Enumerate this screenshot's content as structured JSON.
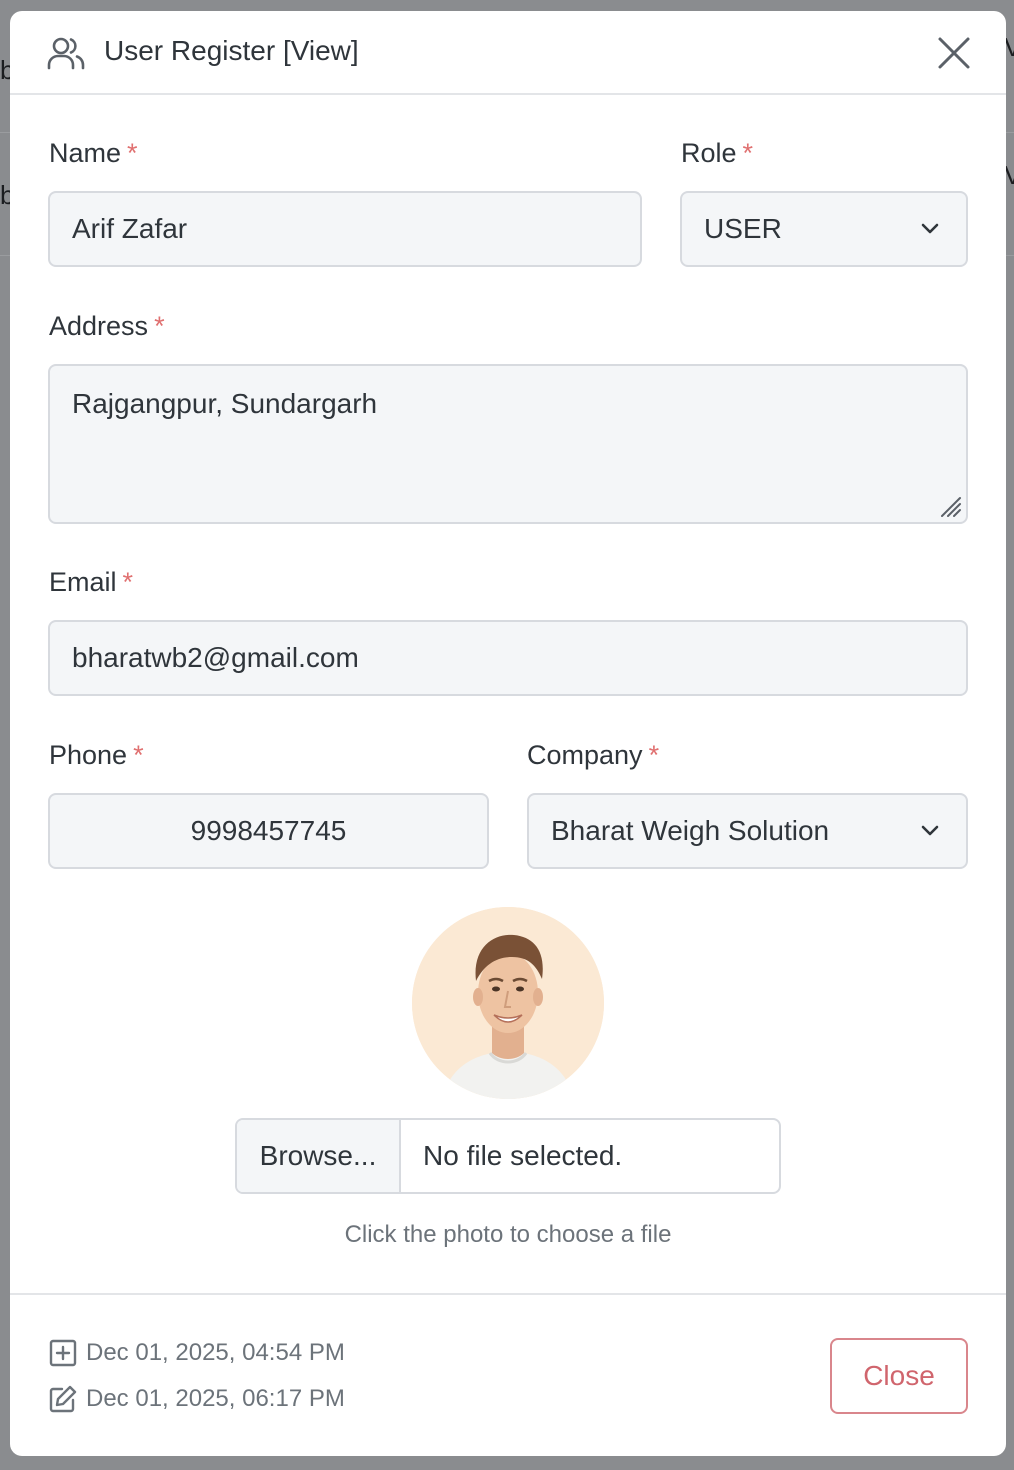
{
  "background": {
    "fragments": [
      "b",
      "b",
      "V",
      "V"
    ]
  },
  "modal": {
    "title": "User Register [View]",
    "header_icon": "users-icon",
    "close_icon": "close-icon"
  },
  "form": {
    "name": {
      "label": "Name",
      "required": "*",
      "value": "Arif Zafar"
    },
    "role": {
      "label": "Role",
      "required": "*",
      "value": "USER"
    },
    "address": {
      "label": "Address",
      "required": "*",
      "value": "Rajgangpur, Sundargarh"
    },
    "email": {
      "label": "Email",
      "required": "*",
      "value": "bharatwb2@gmail.com"
    },
    "phone": {
      "label": "Phone",
      "required": "*",
      "value": "9998457745"
    },
    "company": {
      "label": "Company",
      "required": "*",
      "value": "Bharat Weigh Solution"
    }
  },
  "photo": {
    "browse_label": "Browse...",
    "file_status": "No file selected.",
    "hint": "Click the photo to choose a file"
  },
  "footer": {
    "created": "Dec 01, 2025, 04:54 PM",
    "created_icon": "plus-square-icon",
    "updated": "Dec 01, 2025, 06:17 PM",
    "updated_icon": "edit-icon",
    "close_label": "Close"
  },
  "colors": {
    "required": "#e07070",
    "close_button": "#d0656d",
    "field_bg": "#f4f6f8",
    "overlay": "#7b7d80"
  }
}
